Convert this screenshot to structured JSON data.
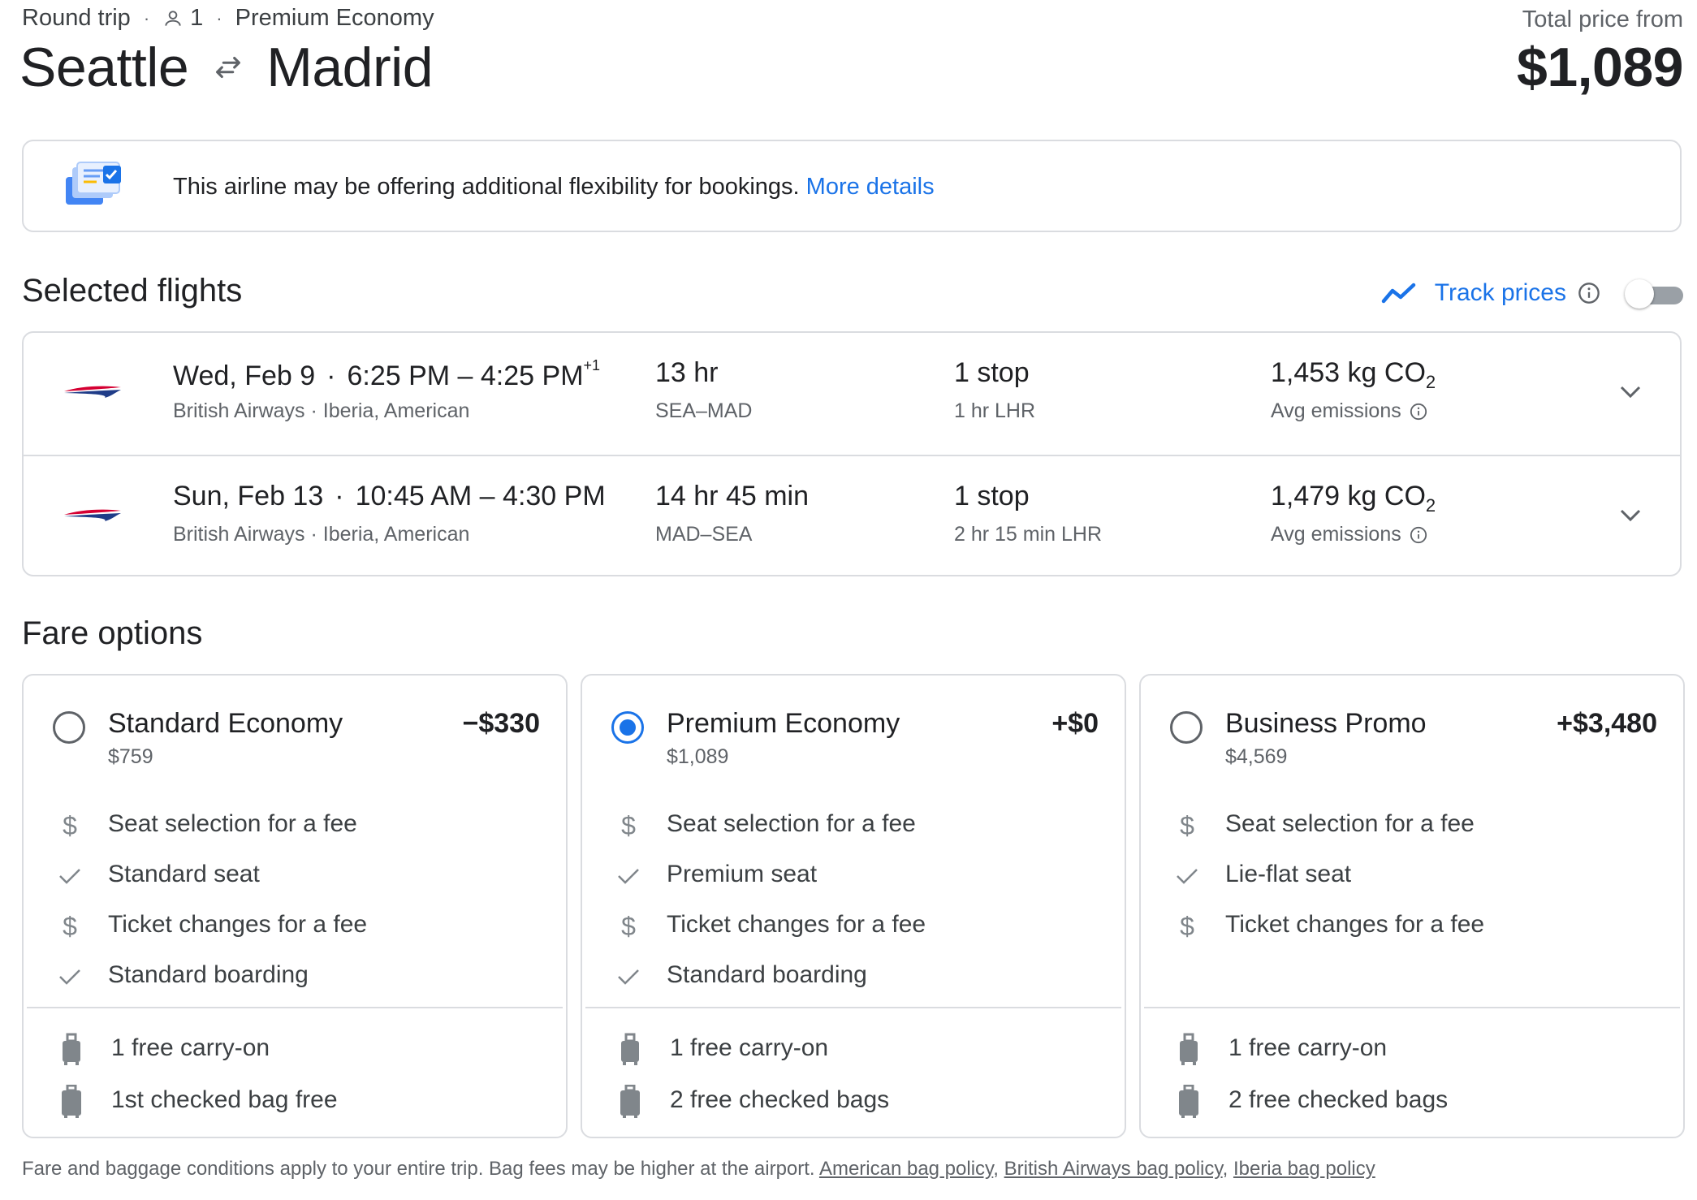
{
  "header": {
    "trip_type": "Round trip",
    "passengers": "1",
    "cabin": "Premium Economy",
    "origin": "Seattle",
    "destination": "Madrid",
    "price_label": "Total price from",
    "price": "$1,089"
  },
  "banner": {
    "text": "This airline may be offering additional flexibility for bookings.",
    "link": "More details"
  },
  "selected_flights": {
    "title": "Selected flights",
    "track_label": "Track prices",
    "track_enabled": false,
    "flights": [
      {
        "date": "Wed, Feb 9",
        "times": "6:25 PM – 4:25 PM",
        "day_offset": "+1",
        "airlines": "British Airways · Iberia, American",
        "duration": "13 hr",
        "route": "SEA–MAD",
        "stops": "1 stop",
        "layover": "1 hr LHR",
        "co2": "1,453 kg CO",
        "co2_sub": "2",
        "emissions": "Avg emissions"
      },
      {
        "date": "Sun, Feb 13",
        "times": "10:45 AM – 4:30 PM",
        "day_offset": "",
        "airlines": "British Airways · Iberia, American",
        "duration": "14 hr 45 min",
        "route": "MAD–SEA",
        "stops": "1 stop",
        "layover": "2 hr 15 min LHR",
        "co2": "1,479 kg CO",
        "co2_sub": "2",
        "emissions": "Avg emissions"
      }
    ]
  },
  "fare_options": {
    "title": "Fare options",
    "fares": [
      {
        "name": "Standard Economy",
        "total": "$759",
        "delta": "−$330",
        "selected": false,
        "features": [
          {
            "icon": "dollar-icon",
            "text": "Seat selection for a fee"
          },
          {
            "icon": "check-icon",
            "text": "Standard seat"
          },
          {
            "icon": "dollar-icon",
            "text": "Ticket changes for a fee"
          },
          {
            "icon": "check-icon",
            "text": "Standard boarding"
          }
        ],
        "bags": [
          {
            "icon": "carry-on-icon",
            "text": "1 free carry-on"
          },
          {
            "icon": "checked-bag-icon",
            "text": "1st checked bag free"
          }
        ]
      },
      {
        "name": "Premium Economy",
        "total": "$1,089",
        "delta": "+$0",
        "selected": true,
        "features": [
          {
            "icon": "dollar-icon",
            "text": "Seat selection for a fee"
          },
          {
            "icon": "check-icon",
            "text": "Premium seat"
          },
          {
            "icon": "dollar-icon",
            "text": "Ticket changes for a fee"
          },
          {
            "icon": "check-icon",
            "text": "Standard boarding"
          }
        ],
        "bags": [
          {
            "icon": "carry-on-icon",
            "text": "1 free carry-on"
          },
          {
            "icon": "checked-bag-icon",
            "text": "2 free checked bags"
          }
        ]
      },
      {
        "name": "Business Promo",
        "total": "$4,569",
        "delta": "+$3,480",
        "selected": false,
        "features": [
          {
            "icon": "dollar-icon",
            "text": "Seat selection for a fee"
          },
          {
            "icon": "check-icon",
            "text": "Lie-flat seat"
          },
          {
            "icon": "dollar-icon",
            "text": "Ticket changes for a fee"
          }
        ],
        "bags": [
          {
            "icon": "carry-on-icon",
            "text": "1 free carry-on"
          },
          {
            "icon": "checked-bag-icon",
            "text": "2 free checked bags"
          }
        ]
      }
    ]
  },
  "footer": {
    "text": "Fare and baggage conditions apply to your entire trip. Bag fees may be higher at the airport.",
    "links": [
      "American bag policy",
      "British Airways bag policy",
      "Iberia bag policy"
    ]
  },
  "colors": {
    "accent": "#1a73e8",
    "text": "#202124",
    "secondary_text": "#5f6368",
    "border": "#dadce0"
  }
}
